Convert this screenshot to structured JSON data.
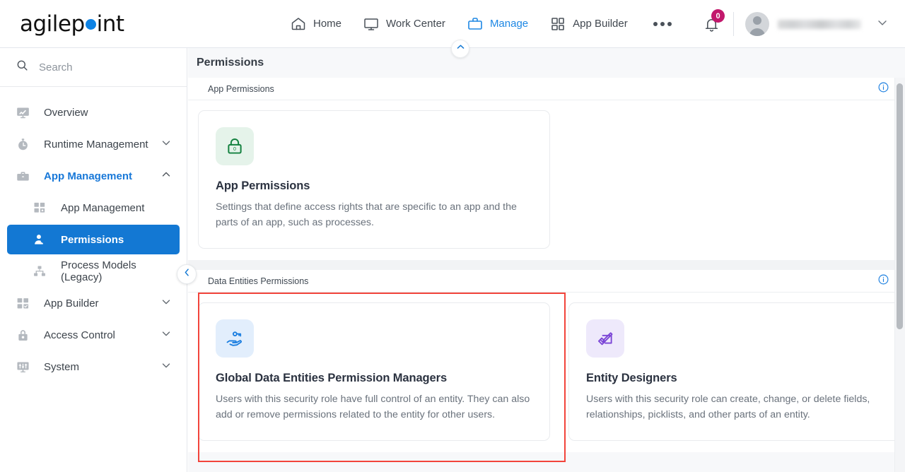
{
  "app": {
    "logo_before": "agilep",
    "logo_after": "int",
    "logo_dot_color": "#0d82e4"
  },
  "topnav": {
    "items": [
      {
        "label": "Home",
        "icon": "home-icon",
        "active": false
      },
      {
        "label": "Work Center",
        "icon": "monitor-icon",
        "active": false
      },
      {
        "label": "Manage",
        "icon": "briefcase-icon",
        "active": true
      },
      {
        "label": "App Builder",
        "icon": "grid-icon",
        "active": false
      }
    ],
    "more_label": "More options",
    "notification_count": "0",
    "user_name": "",
    "accent_color": "#1d87e4",
    "badge_color": "#c2186c"
  },
  "sidebar": {
    "search": {
      "placeholder": "Search",
      "value": ""
    },
    "items": [
      {
        "label": "Overview",
        "icon": "overview-chart-icon",
        "state": "normal",
        "indent": false,
        "chevron": ""
      },
      {
        "label": "Runtime Management",
        "icon": "stopwatch-icon",
        "state": "normal",
        "indent": false,
        "chevron": "down"
      },
      {
        "label": "App Management",
        "icon": "briefcase-icon",
        "state": "expanded",
        "indent": false,
        "chevron": "up"
      },
      {
        "label": "App Management",
        "icon": "grid-apps-icon",
        "state": "normal",
        "indent": true,
        "chevron": ""
      },
      {
        "label": "Permissions",
        "icon": "user-key-icon",
        "state": "selected",
        "indent": true,
        "chevron": ""
      },
      {
        "label": "Process Models (Legacy)",
        "icon": "hierarchy-icon",
        "state": "normal",
        "indent": true,
        "chevron": ""
      },
      {
        "label": "App Builder",
        "icon": "grid-check-icon",
        "state": "normal",
        "indent": false,
        "chevron": "down"
      },
      {
        "label": "Access Control",
        "icon": "lock-icon",
        "state": "normal",
        "indent": false,
        "chevron": "down"
      },
      {
        "label": "System",
        "icon": "sliders-icon",
        "state": "normal",
        "indent": false,
        "chevron": "down"
      }
    ],
    "collapse_icon": "chevron-left-icon"
  },
  "page": {
    "title": "Permissions",
    "collapse_icon": "chevron-up-icon"
  },
  "sections": [
    {
      "title": "App Permissions",
      "info_icon": "info-icon",
      "cards": [
        {
          "title": "App Permissions",
          "description": "Settings that define access rights that are specific to an app and the parts of an app, such as processes.",
          "icon": "lock-permission-icon",
          "icon_theme": "green",
          "highlighted": false
        }
      ]
    },
    {
      "title": "Data Entities Permissions",
      "info_icon": "info-icon",
      "cards": [
        {
          "title": "Global Data Entities Permission Managers",
          "description": "Users with this security role have full control of an entity. They can also add or remove permissions related to the entity for other users.",
          "icon": "hand-key-icon",
          "icon_theme": "blue",
          "highlighted": true
        },
        {
          "title": "Entity Designers",
          "description": "Users with this security role can create, change, or delete fields, relationships, picklists, and other parts of an entity.",
          "icon": "design-tools-icon",
          "icon_theme": "purple",
          "highlighted": false
        }
      ]
    }
  ],
  "highlight_color": "#f2443b"
}
